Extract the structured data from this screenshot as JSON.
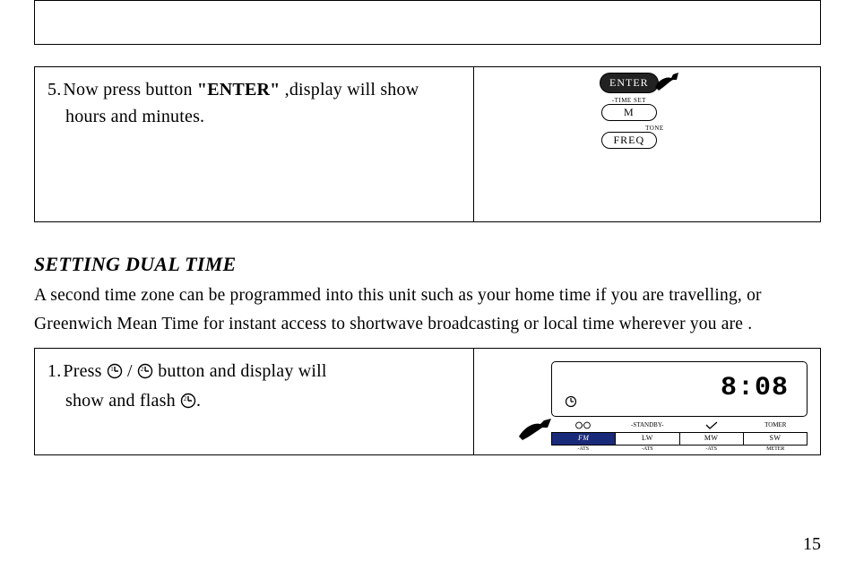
{
  "page_number": "15",
  "step5": {
    "num": "5.",
    "line1_a": "Now press button  ",
    "enter_quoted": "\"ENTER\"",
    "line1_b": " ,display will show",
    "line2": "hours and minutes."
  },
  "buttons_right1": {
    "enter": "ENTER",
    "time_set": "-TIME SET",
    "m": "M",
    "tone": "TONE",
    "freq": "FREQ"
  },
  "section": {
    "title": "SETTING DUAL TIME",
    "desc": "A second time zone can be programmed into this unit such as your home time if you are travelling, or Greenwich Mean Time for instant access to shortwave broadcasting or local time wherever you are ."
  },
  "step1": {
    "num": "1.",
    "a": "Press   ",
    "sep": " / ",
    "b": "    button and display will",
    "line2a": "show and flash ",
    "line2b": "."
  },
  "lcd": {
    "time": "8:08",
    "labels": {
      "dual": "  ",
      "standby": "-STANDBY-",
      "ws": "  ",
      "tomer": "TOMER"
    },
    "bands": {
      "fm": "FM",
      "lw": "LW",
      "mw": "MW",
      "sw": "SW"
    },
    "sub": {
      "ats1": "-ATS",
      "ats2": "-ATS",
      "ats3": "-ATS",
      "meter": "METER"
    }
  }
}
